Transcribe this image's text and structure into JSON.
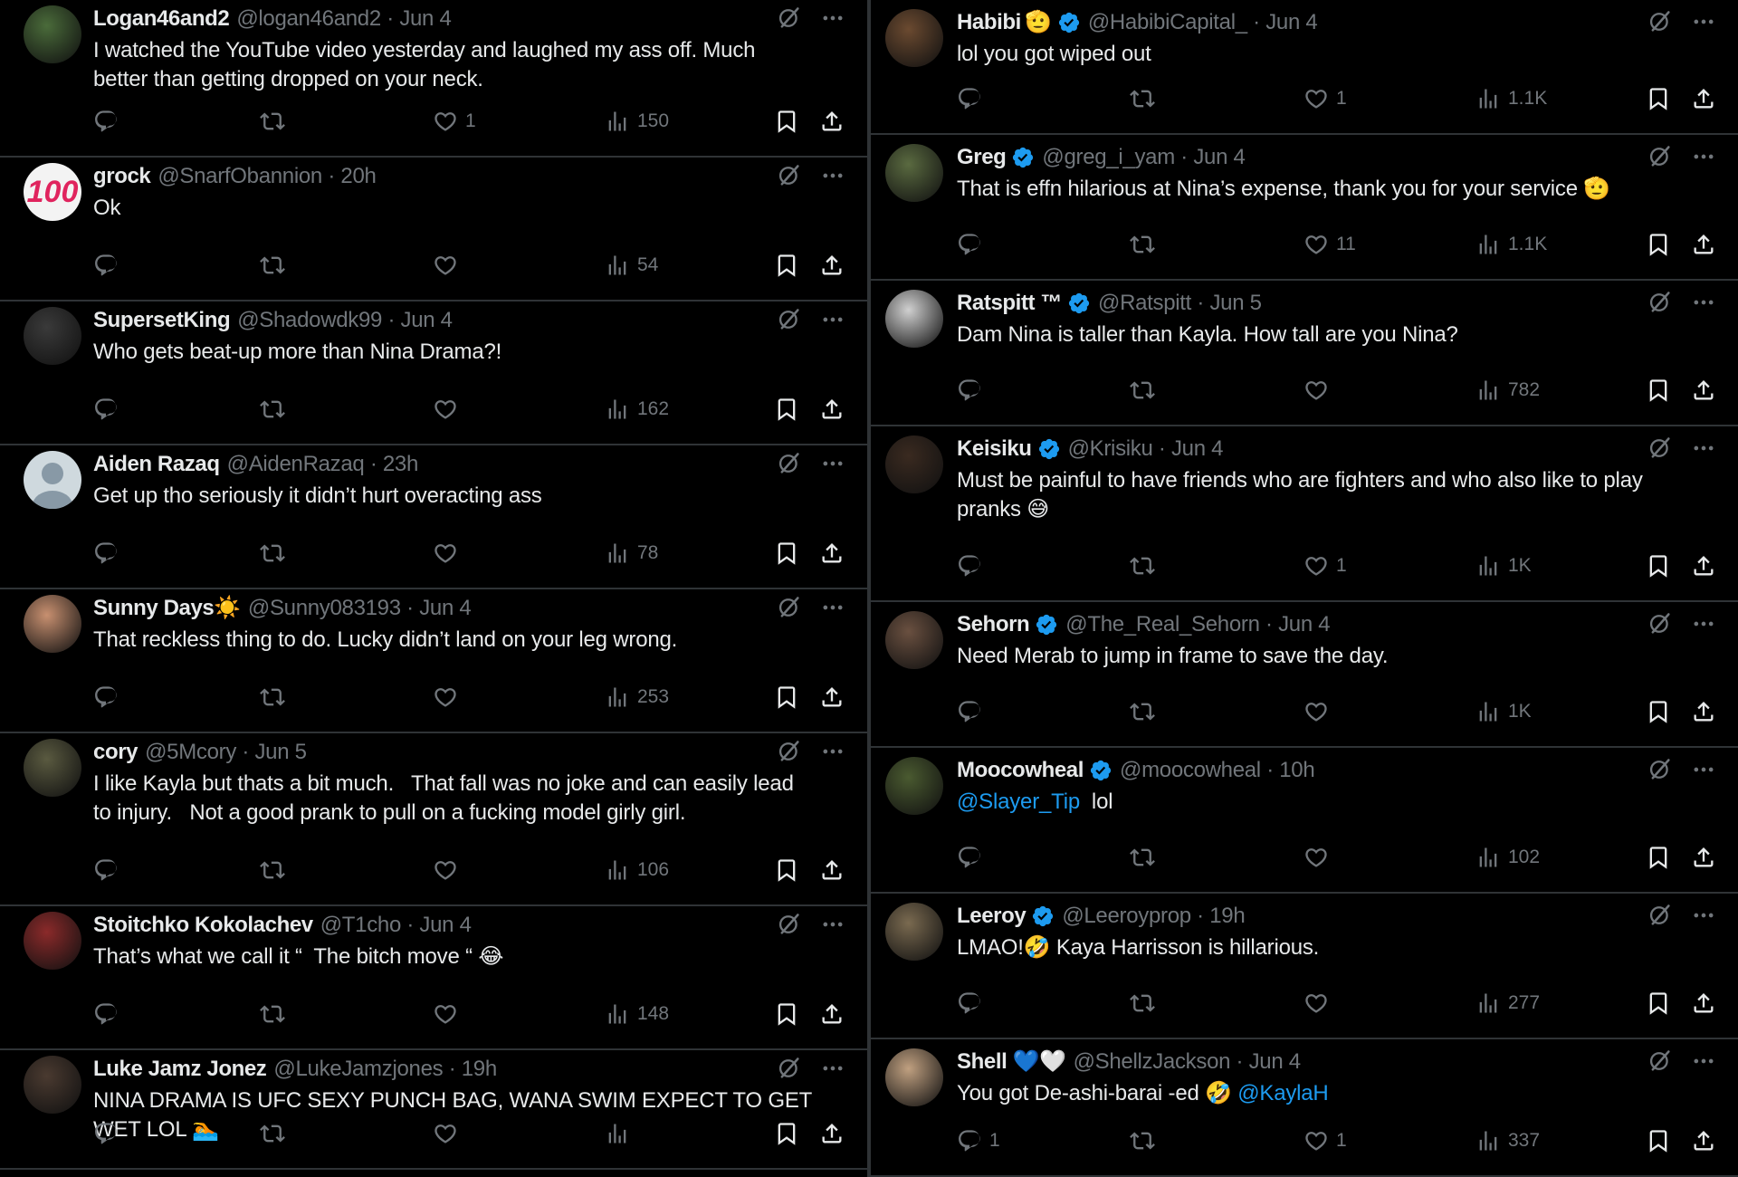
{
  "left": [
    {
      "name": "Logan46and2",
      "handle": "@logan46and2 · Jun 4",
      "verified": false,
      "lines": [
        "I watched the YouTube video yesterday and laughed my ass off. Much",
        "better than getting dropped on your neck."
      ],
      "replies": "",
      "retweets": "",
      "likes": "1",
      "views": "150",
      "avatar_color": "#4a6b3a"
    },
    {
      "name": "grock",
      "handle": "@SnarfObannion · 20h",
      "verified": false,
      "lines": [
        "Ok"
      ],
      "replies": "",
      "retweets": "",
      "likes": "",
      "views": "54",
      "avatar_color": "#f3f3f3",
      "avatar_glyph": "💯"
    },
    {
      "name": "SupersetKing",
      "handle": "@Shadowdk99 · Jun 4",
      "verified": false,
      "lines": [
        "Who gets beat-up more than Nina Drama?!"
      ],
      "replies": "",
      "retweets": "",
      "likes": "",
      "views": "162",
      "avatar_color": "#3a3a3a"
    },
    {
      "name": "Aiden Razaq",
      "handle": "@AidenRazaq · 23h",
      "verified": false,
      "lines": [
        "Get up tho seriously it didn’t hurt overacting ass"
      ],
      "replies": "",
      "retweets": "",
      "likes": "",
      "views": "78",
      "avatar_color": "#cfd9de",
      "default_avatar": true
    },
    {
      "name": "Sunny Days☀️",
      "handle": "@Sunny083193 · Jun 4",
      "verified": false,
      "lines": [
        "That reckless thing to do. Lucky didn’t land on your leg wrong."
      ],
      "replies": "",
      "retweets": "",
      "likes": "",
      "views": "253",
      "avatar_color": "#c89070"
    },
    {
      "name": "cory",
      "handle": "@5Mcory · Jun 5",
      "verified": false,
      "lines": [
        "I like Kayla but thats a bit much.   That fall was no joke and can easily lead",
        "to injury.   Not a good prank to pull on a fucking model girly girl."
      ],
      "replies": "",
      "retweets": "",
      "likes": "",
      "views": "106",
      "avatar_color": "#5a5a40"
    },
    {
      "name": "Stoitchko Kokolachev",
      "handle": "@T1cho · Jun 4",
      "verified": false,
      "lines": [
        "That’s what we call it “  The bitch move “ 😂"
      ],
      "replies": "",
      "retweets": "",
      "likes": "",
      "views": "148",
      "avatar_color": "#8b2a2a"
    },
    {
      "name": "Luke Jamz Jonez",
      "handle": "@LukeJamzjones · 19h",
      "verified": false,
      "lines": [
        "NINA DRAMA IS UFC SEXY PUNCH BAG, WANA SWIM EXPECT TO GET",
        "WET LOL 🏊"
      ],
      "replies": "",
      "retweets": "",
      "likes": "",
      "views": "",
      "avatar_color": "#4a3a30"
    }
  ],
  "right": [
    {
      "name": "Habibi",
      "emoji": "🫡",
      "handle": "@HabibiCapital_ · Jun 4",
      "verified": true,
      "lines": [
        "lol you got wiped out"
      ],
      "replies": "",
      "retweets": "",
      "likes": "1",
      "views": "1.1K",
      "avatar_color": "#6b4a30"
    },
    {
      "name": "Greg",
      "handle": "@greg_i_yam · Jun 4",
      "verified": true,
      "lines": [
        "That is effn hilarious at Nina’s expense, thank you for your service 🫡"
      ],
      "replies": "",
      "retweets": "",
      "likes": "11",
      "views": "1.1K",
      "avatar_color": "#5a6a40"
    },
    {
      "name": "Ratspitt ™",
      "handle": "@Ratspitt · Jun 5",
      "verified": true,
      "lines": [
        "Dam Nina is taller than Kayla. How tall are you Nina?"
      ],
      "replies": "",
      "retweets": "",
      "likes": "",
      "views": "782",
      "avatar_color": "#d0d0d0"
    },
    {
      "name": "Keisiku",
      "handle": "@Krisiku · Jun 4",
      "verified": true,
      "lines": [
        "Must be painful to have friends who are fighters and who also like to play",
        "pranks 😅"
      ],
      "replies": "",
      "retweets": "",
      "likes": "1",
      "views": "1K",
      "avatar_color": "#3a2a20"
    },
    {
      "name": "Sehorn",
      "handle": "@The_Real_Sehorn · Jun 4",
      "verified": true,
      "lines": [
        "Need Merab to jump in frame to save the day."
      ],
      "replies": "",
      "retweets": "",
      "likes": "",
      "views": "1K",
      "avatar_color": "#6a5040"
    },
    {
      "name": "Moocowheal",
      "handle": "@moocowheal · 10h",
      "verified": true,
      "lines": [
        "@Slayer_Tip  lol"
      ],
      "mention": "@Slayer_Tip",
      "rest": "  lol",
      "replies": "",
      "retweets": "",
      "likes": "",
      "views": "102",
      "avatar_color": "#4a5a30"
    },
    {
      "name": "Leeroy",
      "handle": "@Leeroyprop · 19h",
      "verified": true,
      "lines": [
        "LMAO!🤣 Kaya Harrisson is hillarious."
      ],
      "replies": "",
      "retweets": "",
      "likes": "",
      "views": "277",
      "avatar_color": "#7a6a50"
    },
    {
      "name": "Shell 💙🤍",
      "handle": "@ShellzJackson · Jun 4",
      "verified": false,
      "lines": [
        "You got De-ashi-barai -ed 🤣 @KaylaH"
      ],
      "prefix": "You got De-ashi-barai -ed 🤣 ",
      "mention": "@KaylaH",
      "replies": "1",
      "retweets": "",
      "likes": "1",
      "views": "337",
      "avatar_color": "#c0a080"
    }
  ]
}
